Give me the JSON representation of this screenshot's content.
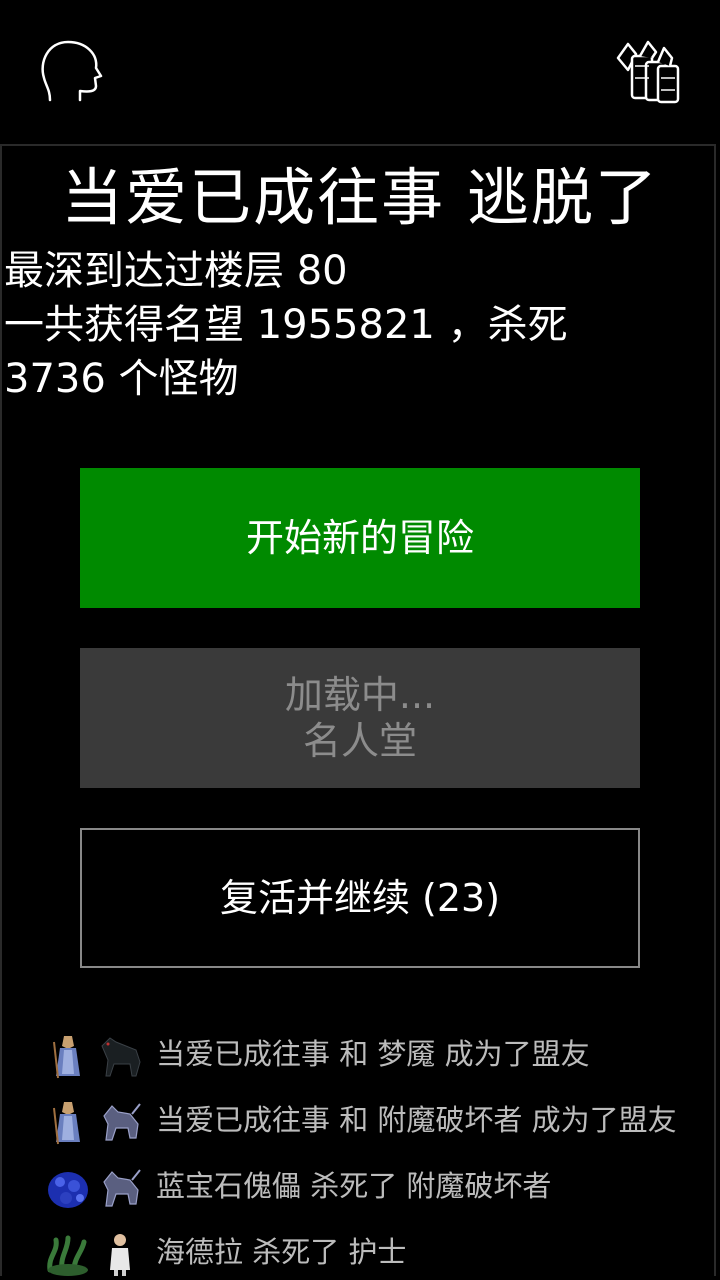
{
  "header": {
    "profile_icon": "head-silhouette-icon",
    "social_icon": "group-cards-icon"
  },
  "title": "当爱已成往事 逃脱了",
  "stats": {
    "line1": "最深到达过楼层 80",
    "line2": "一共获得名望 1955821 ，杀死",
    "line3": "3736 个怪物"
  },
  "buttons": {
    "new_adventure": "开始新的冒险",
    "hall_loading": "加载中...",
    "hall_of_fame": "名人堂",
    "revive": "复活并继续 (23)"
  },
  "colors": {
    "background": "#000000",
    "primary_button": "#008a00",
    "disabled_button": "#3a3a3a",
    "disabled_text": "#8c8c8c",
    "feed_text": "#bcbcbc"
  },
  "feed": [
    {
      "text": "当爱已成往事 和 梦魇 成为了盟友",
      "icon1": "wizard-hero-icon",
      "icon2": "nightmare-horse-icon"
    },
    {
      "text": "当爱已成往事 和 附魔破坏者 成为了盟友",
      "icon1": "wizard-hero-icon",
      "icon2": "enchanted-destroyer-icon"
    },
    {
      "text": "蓝宝石傀儡 杀死了 附魔破坏者",
      "icon1": "sapphire-golem-icon",
      "icon2": "enchanted-destroyer-icon"
    },
    {
      "text": "海德拉 杀死了 护士",
      "icon1": "hydra-icon",
      "icon2": "nurse-icon"
    }
  ]
}
